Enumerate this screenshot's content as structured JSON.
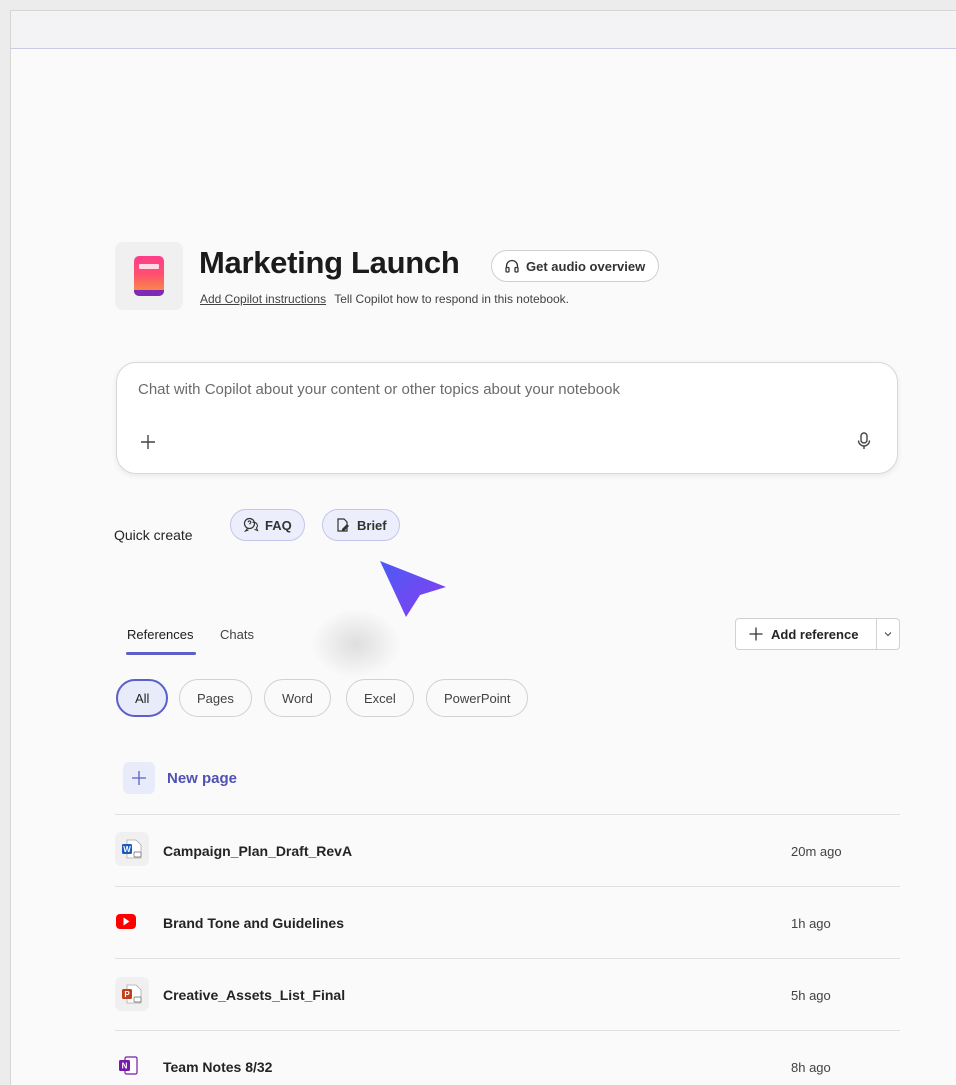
{
  "notebook": {
    "title": "Marketing Launch",
    "audio_button": "Get audio overview",
    "instructions_link": "Add Copilot instructions",
    "instructions_text": "Tell Copilot how to respond in this notebook."
  },
  "chat": {
    "placeholder": "Chat with Copilot about your content or other topics about your notebook"
  },
  "quick_create": {
    "label": "Quick create",
    "chips": [
      {
        "label": "FAQ",
        "icon": "faq-icon"
      },
      {
        "label": "Brief",
        "icon": "brief-icon"
      }
    ]
  },
  "tabs": [
    {
      "label": "References",
      "active": true
    },
    {
      "label": "Chats",
      "active": false
    }
  ],
  "add_reference": {
    "label": "Add reference"
  },
  "filters": [
    "All",
    "Pages",
    "Word",
    "Excel",
    "PowerPoint"
  ],
  "new_page": {
    "label": "New page"
  },
  "references": [
    {
      "name": "Campaign_Plan_Draft_RevA",
      "time": "20m ago",
      "icon": "word-file-icon"
    },
    {
      "name": "Brand Tone and Guidelines",
      "time": "1h ago",
      "icon": "youtube-icon"
    },
    {
      "name": "Creative_Assets_List_Final",
      "time": "5h ago",
      "icon": "powerpoint-file-icon"
    },
    {
      "name": "Team Notes 8/32",
      "time": "8h ago",
      "icon": "onenote-icon"
    }
  ],
  "colors": {
    "accent": "#5b5fc7",
    "word": "#185abd",
    "youtube": "#ff0000",
    "powerpoint": "#c43e1c",
    "onenote": "#7719aa",
    "cursor": "#6a4cf0"
  }
}
